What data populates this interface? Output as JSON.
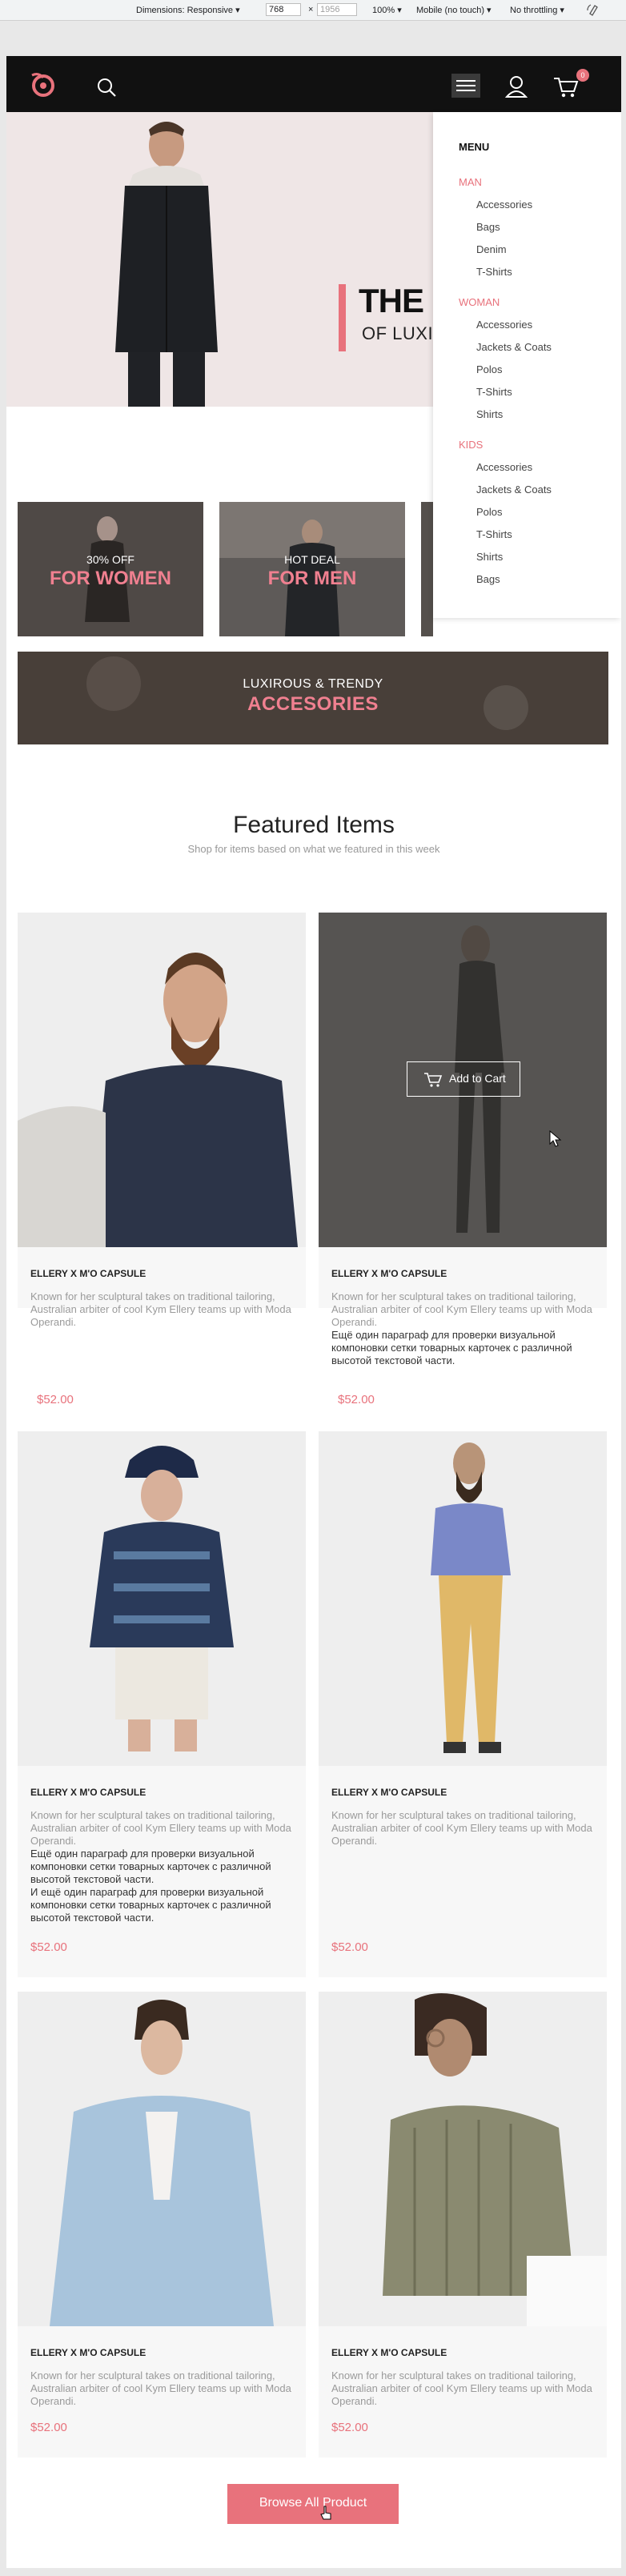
{
  "devtools": {
    "dimensions_label": "Dimensions: Responsive ▾",
    "width_value": "768",
    "times": "×",
    "height_placeholder": "1956",
    "zoom": "100% ▾",
    "device": "Mobile (no touch) ▾",
    "throttling": "No throttling ▾"
  },
  "header": {
    "cart_count": "0"
  },
  "hero": {
    "title": "THE",
    "subtitle": "OF LUXI"
  },
  "promos": [
    {
      "line1": "30% OFF",
      "line2": "FOR WOMEN"
    },
    {
      "line1": "HOT DEAL",
      "line2": "FOR MEN"
    }
  ],
  "banner": {
    "line1": "LUXIROUS & TRENDY",
    "line2": "ACCESORIES"
  },
  "menu": {
    "heading": "MENU",
    "categories": [
      {
        "label": "MAN",
        "items": [
          "Accessories",
          "Bags",
          "Denim",
          "T-Shirts"
        ]
      },
      {
        "label": "WOMAN",
        "items": [
          "Accessories",
          "Jackets & Coats",
          "Polos",
          "T-Shirts",
          "Shirts"
        ]
      },
      {
        "label": "KIDS",
        "items": [
          "Accessories",
          "Jackets & Coats",
          "Polos",
          "T-Shirts",
          "Shirts",
          "Bags"
        ]
      }
    ]
  },
  "featured": {
    "title": "Featured Items",
    "subtitle": "Shop for items based on what we featured in this week",
    "add_to_cart": "Add to Cart",
    "browse_all": "Browse All Product",
    "products": [
      {
        "name": "ELLERY X M'O CAPSULE",
        "desc": "Known for her sculptural takes on traditional tailoring, Australian arbiter of cool Kym Ellery teams up with Moda Operandi.",
        "extra": "",
        "price": "$52.00"
      },
      {
        "name": "ELLERY X M'O CAPSULE",
        "desc": "Known for her sculptural takes on traditional tailoring, Australian arbiter of cool Kym Ellery teams up with Moda Operandi.",
        "extra": "Ещё один параграф для проверки визуальной компоновки сетки товарных карточек с различной высотой текстовой части.",
        "price": "$52.00"
      },
      {
        "name": "ELLERY X M'O CAPSULE",
        "desc": "Known for her sculptural takes on traditional tailoring, Australian arbiter of cool Kym Ellery teams up with Moda Operandi.",
        "extra": "Ещё один параграф для проверки визуальной компоновки сетки товарных карточек с различной высотой текстовой части.",
        "extra2": "И ещё один параграф для проверки визуальной компоновки сетки товарных карточек с различной высотой текстовой части.",
        "price": "$52.00"
      },
      {
        "name": "ELLERY X M'O CAPSULE",
        "desc": "Known for her sculptural takes on traditional tailoring, Australian arbiter of cool Kym Ellery teams up with Moda Operandi.",
        "extra": "",
        "price": "$52.00"
      },
      {
        "name": "ELLERY X M'O CAPSULE",
        "desc": "Known for her sculptural takes on traditional tailoring, Australian arbiter of cool Kym Ellery teams up with Moda Operandi.",
        "extra": "",
        "price": "$52.00"
      },
      {
        "name": "ELLERY X M'O CAPSULE",
        "desc": "Known for her sculptural takes on traditional tailoring, Australian arbiter of cool Kym Ellery teams up with Moda Operandi.",
        "extra": "",
        "price": "$52.00"
      }
    ]
  },
  "colors": {
    "accent": "#e8727c",
    "header_bg": "#111111",
    "hero_bg": "#efe6e6"
  }
}
